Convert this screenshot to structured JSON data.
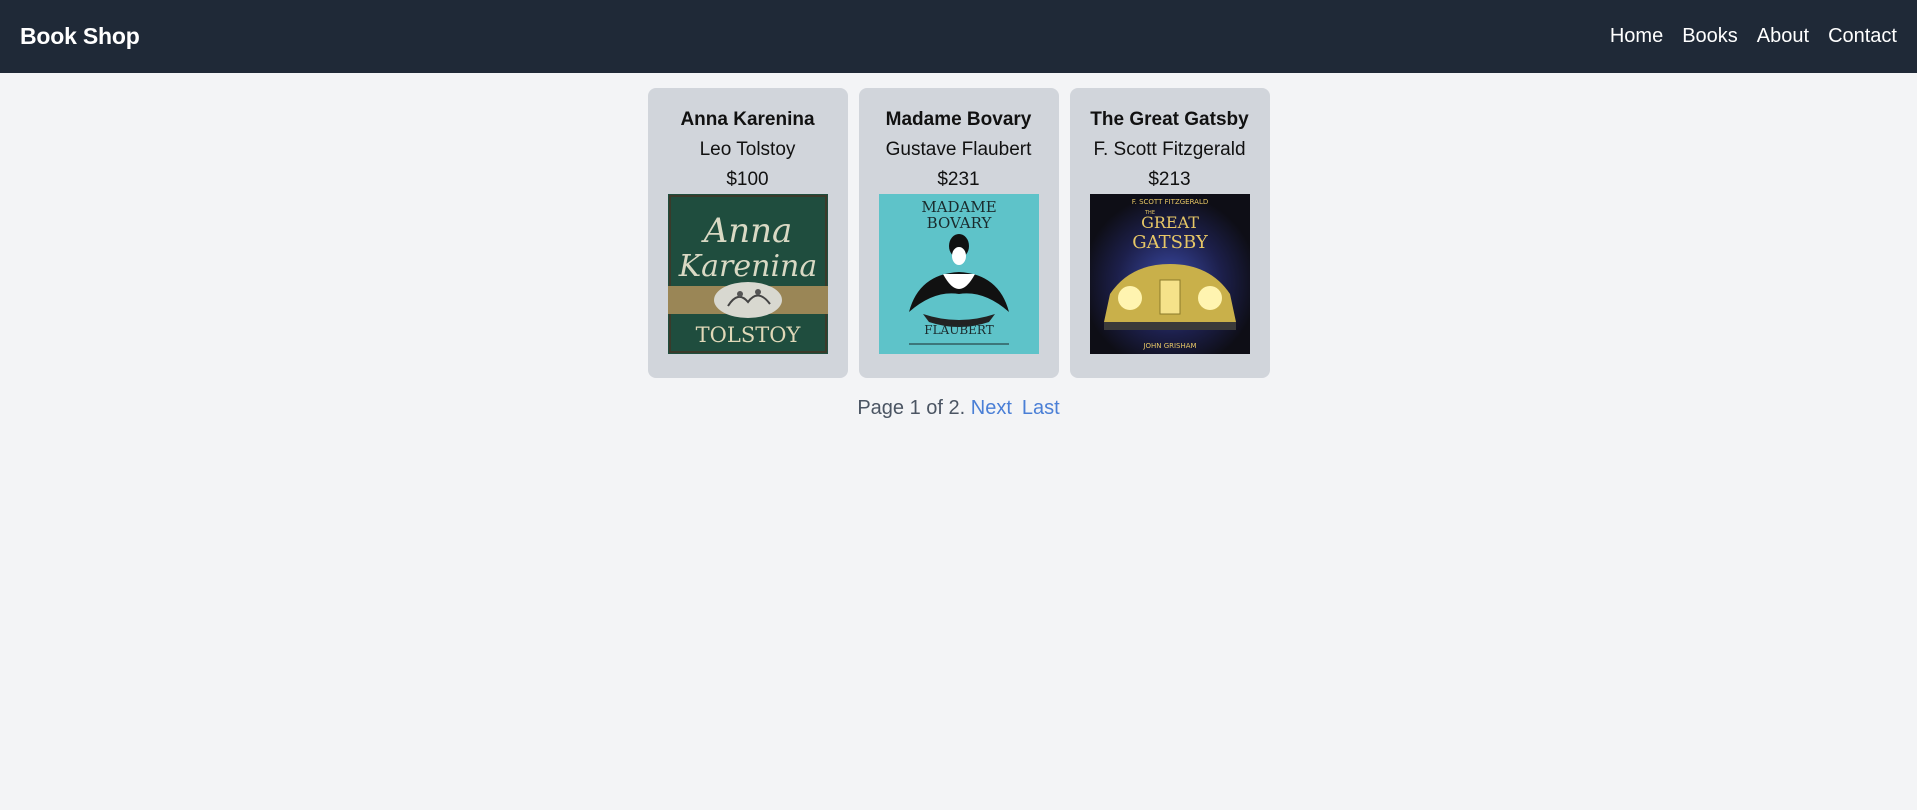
{
  "header": {
    "brand": "Book Shop",
    "nav": [
      "Home",
      "Books",
      "About",
      "Contact"
    ]
  },
  "books": [
    {
      "title": "Anna Karenina",
      "author": "Leo Tolstoy",
      "price": "$100",
      "cover": {
        "script_title_1": "Anna",
        "script_title_2": "Karenina",
        "footer": "TOLSTOY",
        "bg": "#1f4d3e"
      }
    },
    {
      "title": "Madame Bovary",
      "author": "Gustave Flaubert",
      "price": "$231",
      "cover": {
        "top_1": "MADAME",
        "top_2": "BOVARY",
        "footer": "FLAUBERT",
        "bg": "#5ec3c9"
      }
    },
    {
      "title": "The Great Gatsby",
      "author": "F. Scott Fitzgerald",
      "price": "$213",
      "cover": {
        "top": "F. SCOTT FITZGERALD",
        "the": "THE",
        "main_1": "GREAT",
        "main_2": "GATSBY",
        "footer": "JOHN GRISHAM",
        "bg": "#151515"
      }
    }
  ],
  "pagination": {
    "status": "Page 1 of 2.",
    "next": "Next",
    "last": "Last"
  },
  "colors": {
    "topbar": "#1f2937",
    "background": "#f3f4f6",
    "card": "#d1d5db",
    "link": "#4a7fd6"
  }
}
